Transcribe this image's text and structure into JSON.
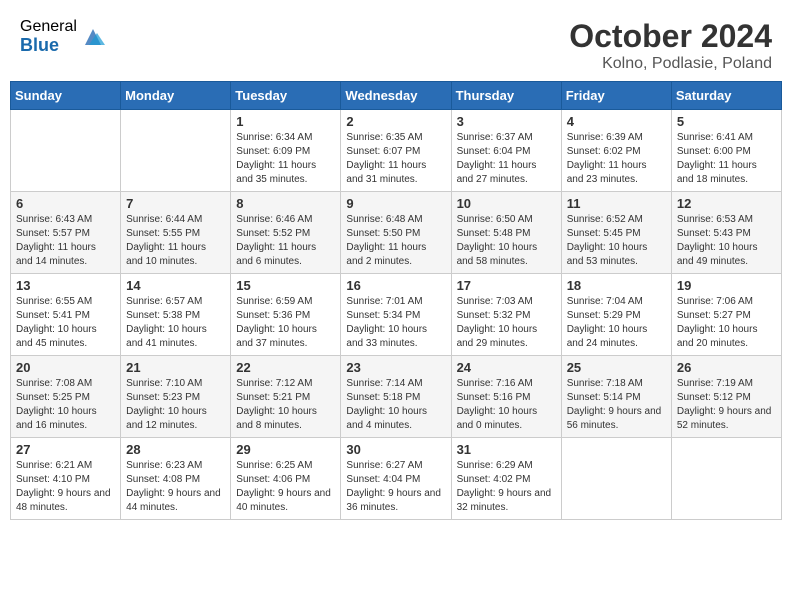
{
  "header": {
    "logo_general": "General",
    "logo_blue": "Blue",
    "month": "October 2024",
    "location": "Kolno, Podlasie, Poland"
  },
  "weekdays": [
    "Sunday",
    "Monday",
    "Tuesday",
    "Wednesday",
    "Thursday",
    "Friday",
    "Saturday"
  ],
  "weeks": [
    [
      {
        "day": "",
        "info": ""
      },
      {
        "day": "",
        "info": ""
      },
      {
        "day": "1",
        "info": "Sunrise: 6:34 AM\nSunset: 6:09 PM\nDaylight: 11 hours and 35 minutes."
      },
      {
        "day": "2",
        "info": "Sunrise: 6:35 AM\nSunset: 6:07 PM\nDaylight: 11 hours and 31 minutes."
      },
      {
        "day": "3",
        "info": "Sunrise: 6:37 AM\nSunset: 6:04 PM\nDaylight: 11 hours and 27 minutes."
      },
      {
        "day": "4",
        "info": "Sunrise: 6:39 AM\nSunset: 6:02 PM\nDaylight: 11 hours and 23 minutes."
      },
      {
        "day": "5",
        "info": "Sunrise: 6:41 AM\nSunset: 6:00 PM\nDaylight: 11 hours and 18 minutes."
      }
    ],
    [
      {
        "day": "6",
        "info": "Sunrise: 6:43 AM\nSunset: 5:57 PM\nDaylight: 11 hours and 14 minutes."
      },
      {
        "day": "7",
        "info": "Sunrise: 6:44 AM\nSunset: 5:55 PM\nDaylight: 11 hours and 10 minutes."
      },
      {
        "day": "8",
        "info": "Sunrise: 6:46 AM\nSunset: 5:52 PM\nDaylight: 11 hours and 6 minutes."
      },
      {
        "day": "9",
        "info": "Sunrise: 6:48 AM\nSunset: 5:50 PM\nDaylight: 11 hours and 2 minutes."
      },
      {
        "day": "10",
        "info": "Sunrise: 6:50 AM\nSunset: 5:48 PM\nDaylight: 10 hours and 58 minutes."
      },
      {
        "day": "11",
        "info": "Sunrise: 6:52 AM\nSunset: 5:45 PM\nDaylight: 10 hours and 53 minutes."
      },
      {
        "day": "12",
        "info": "Sunrise: 6:53 AM\nSunset: 5:43 PM\nDaylight: 10 hours and 49 minutes."
      }
    ],
    [
      {
        "day": "13",
        "info": "Sunrise: 6:55 AM\nSunset: 5:41 PM\nDaylight: 10 hours and 45 minutes."
      },
      {
        "day": "14",
        "info": "Sunrise: 6:57 AM\nSunset: 5:38 PM\nDaylight: 10 hours and 41 minutes."
      },
      {
        "day": "15",
        "info": "Sunrise: 6:59 AM\nSunset: 5:36 PM\nDaylight: 10 hours and 37 minutes."
      },
      {
        "day": "16",
        "info": "Sunrise: 7:01 AM\nSunset: 5:34 PM\nDaylight: 10 hours and 33 minutes."
      },
      {
        "day": "17",
        "info": "Sunrise: 7:03 AM\nSunset: 5:32 PM\nDaylight: 10 hours and 29 minutes."
      },
      {
        "day": "18",
        "info": "Sunrise: 7:04 AM\nSunset: 5:29 PM\nDaylight: 10 hours and 24 minutes."
      },
      {
        "day": "19",
        "info": "Sunrise: 7:06 AM\nSunset: 5:27 PM\nDaylight: 10 hours and 20 minutes."
      }
    ],
    [
      {
        "day": "20",
        "info": "Sunrise: 7:08 AM\nSunset: 5:25 PM\nDaylight: 10 hours and 16 minutes."
      },
      {
        "day": "21",
        "info": "Sunrise: 7:10 AM\nSunset: 5:23 PM\nDaylight: 10 hours and 12 minutes."
      },
      {
        "day": "22",
        "info": "Sunrise: 7:12 AM\nSunset: 5:21 PM\nDaylight: 10 hours and 8 minutes."
      },
      {
        "day": "23",
        "info": "Sunrise: 7:14 AM\nSunset: 5:18 PM\nDaylight: 10 hours and 4 minutes."
      },
      {
        "day": "24",
        "info": "Sunrise: 7:16 AM\nSunset: 5:16 PM\nDaylight: 10 hours and 0 minutes."
      },
      {
        "day": "25",
        "info": "Sunrise: 7:18 AM\nSunset: 5:14 PM\nDaylight: 9 hours and 56 minutes."
      },
      {
        "day": "26",
        "info": "Sunrise: 7:19 AM\nSunset: 5:12 PM\nDaylight: 9 hours and 52 minutes."
      }
    ],
    [
      {
        "day": "27",
        "info": "Sunrise: 6:21 AM\nSunset: 4:10 PM\nDaylight: 9 hours and 48 minutes."
      },
      {
        "day": "28",
        "info": "Sunrise: 6:23 AM\nSunset: 4:08 PM\nDaylight: 9 hours and 44 minutes."
      },
      {
        "day": "29",
        "info": "Sunrise: 6:25 AM\nSunset: 4:06 PM\nDaylight: 9 hours and 40 minutes."
      },
      {
        "day": "30",
        "info": "Sunrise: 6:27 AM\nSunset: 4:04 PM\nDaylight: 9 hours and 36 minutes."
      },
      {
        "day": "31",
        "info": "Sunrise: 6:29 AM\nSunset: 4:02 PM\nDaylight: 9 hours and 32 minutes."
      },
      {
        "day": "",
        "info": ""
      },
      {
        "day": "",
        "info": ""
      }
    ]
  ]
}
